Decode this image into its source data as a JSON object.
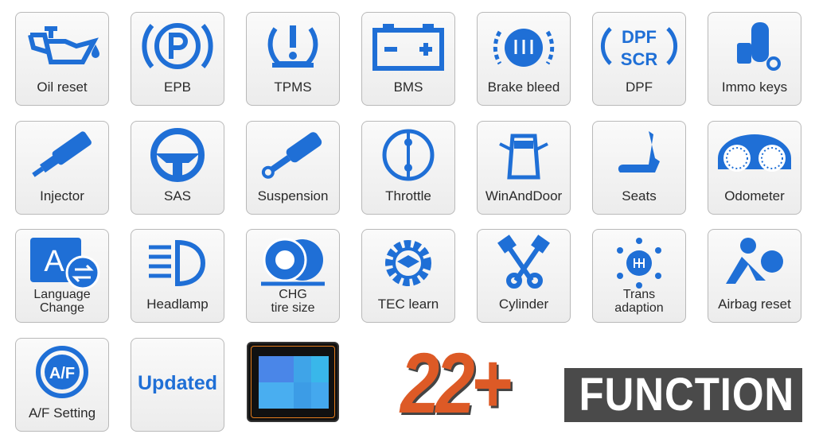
{
  "accent_color": "#1f6fd6",
  "tiles": [
    {
      "label": "Oil reset",
      "icon": "oil-can-icon"
    },
    {
      "label": "EPB",
      "icon": "parking-brake-icon"
    },
    {
      "label": "TPMS",
      "icon": "tire-pressure-icon"
    },
    {
      "label": "BMS",
      "icon": "battery-icon"
    },
    {
      "label": "Brake bleed",
      "icon": "brake-fluid-icon"
    },
    {
      "label": "DPF",
      "icon": "dpf-scr-icon",
      "text": [
        "DPF",
        "SCR"
      ]
    },
    {
      "label": "Immo keys",
      "icon": "key-fob-icon"
    },
    {
      "label": "Injector",
      "icon": "injector-icon"
    },
    {
      "label": "SAS",
      "icon": "steering-wheel-icon"
    },
    {
      "label": "Suspension",
      "icon": "shock-absorber-icon"
    },
    {
      "label": "Throttle",
      "icon": "throttle-icon"
    },
    {
      "label": "WinAndDoor",
      "icon": "car-doors-icon"
    },
    {
      "label": "Seats",
      "icon": "seat-icon"
    },
    {
      "label": "Odometer",
      "icon": "gauge-cluster-icon"
    },
    {
      "label": "Language Change",
      "icon": "language-icon",
      "text": [
        "A"
      ]
    },
    {
      "label": "Headlamp",
      "icon": "headlamp-icon"
    },
    {
      "label": "CHG tire size",
      "icon": "tire-icon"
    },
    {
      "label": "TEC learn",
      "icon": "gear-graduation-icon"
    },
    {
      "label": "Cylinder",
      "icon": "pistons-icon"
    },
    {
      "label": "Trans adaption",
      "icon": "gearbox-icon"
    },
    {
      "label": "Airbag reset",
      "icon": "airbag-icon"
    },
    {
      "label": "A/F Setting",
      "icon": "air-fuel-icon",
      "text": [
        "A/F"
      ]
    },
    {
      "label": "",
      "badge": "Updated"
    }
  ],
  "promo": {
    "count": "22+",
    "word": "FUNCTION"
  },
  "tablet": {
    "screen_colors": [
      "#4a86e8",
      "#3fa4e8",
      "#39b7ea",
      "#49aef0",
      "#3c9ce6",
      "#44a8ee",
      "#3a90e0",
      "#4fb4f2"
    ]
  }
}
